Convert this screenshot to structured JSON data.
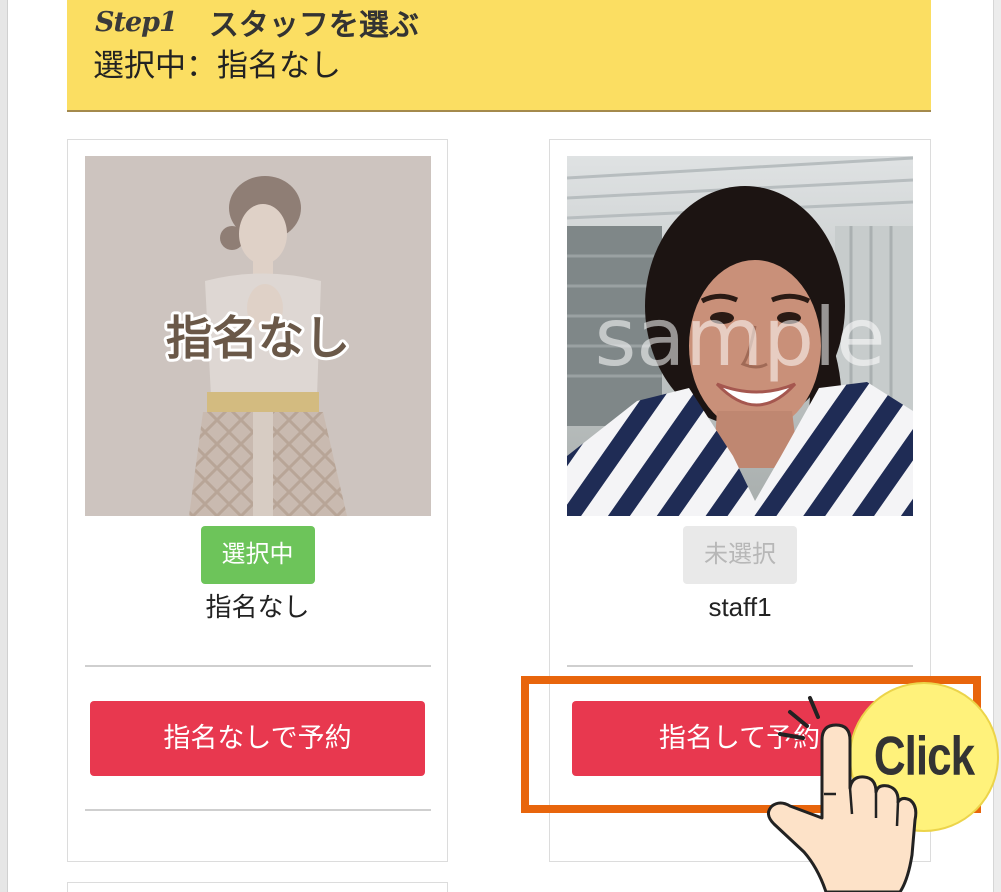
{
  "header": {
    "step_label": "Step1",
    "title": "スタッフを選ぶ",
    "current_selection": "選択中：指名なし"
  },
  "staff_cards": [
    {
      "image_label": "指名なし",
      "status": "選択中",
      "name": "指名なし",
      "reserve_button": "指名なしで予約",
      "selected": true
    },
    {
      "image_watermark": "sample",
      "status": "未選択",
      "name": "staff1",
      "reserve_button": "指名して予約",
      "selected": false
    }
  ],
  "callout": {
    "label": "Click",
    "icon": "pointing-hand-icon"
  },
  "colors": {
    "header_background": "#fbde62",
    "reserve_button": "#e8384f",
    "selected_badge": "#6dc45a",
    "unselected_badge": "#e9e9e9",
    "highlight_frame": "#e8650c",
    "callout_circle": "#fff27b"
  }
}
